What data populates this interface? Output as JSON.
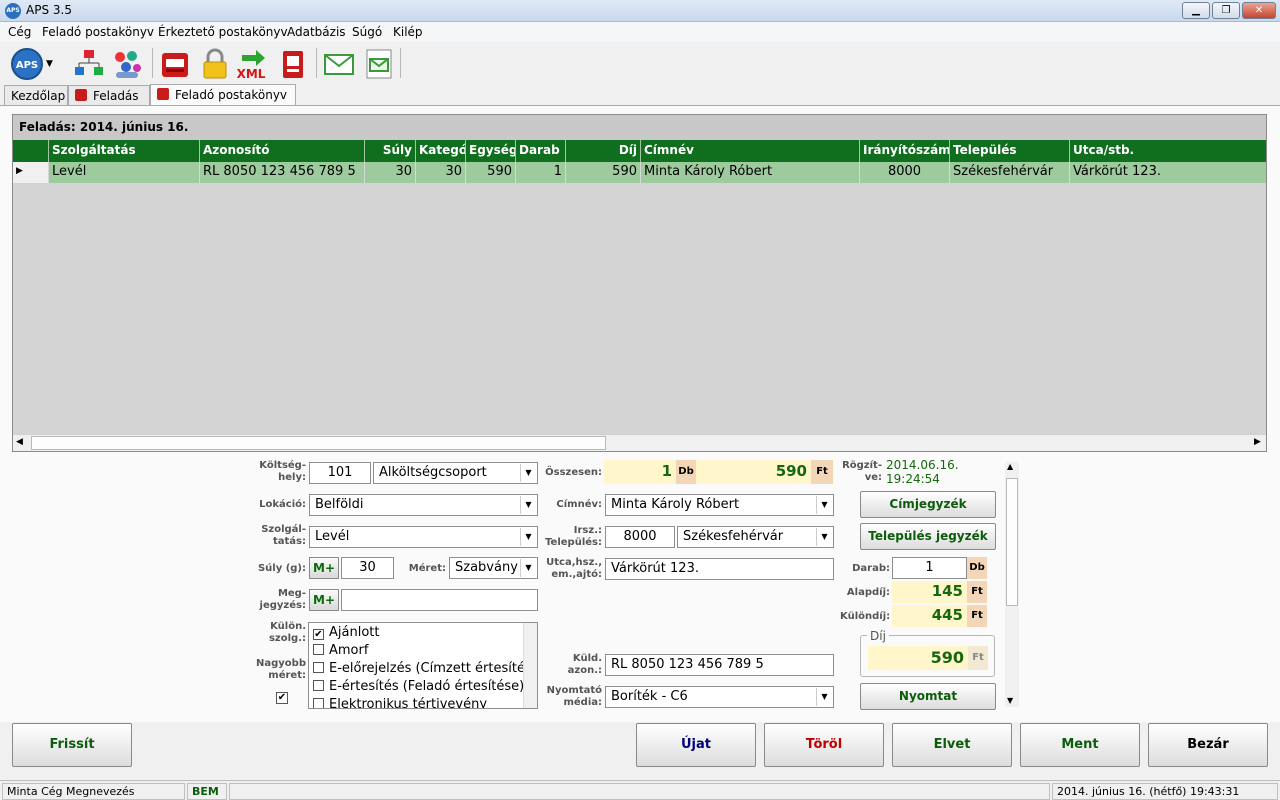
{
  "window": {
    "title": "APS 3.5",
    "minimize": "▁",
    "maximize": "❐",
    "close": "✕"
  },
  "menu": [
    "Cég",
    "Feladó postakönyv",
    "Érkeztető postakönyv",
    "Adatbázis",
    "Súgó",
    "Kilép"
  ],
  "toolbar": {
    "aps_label": "APS",
    "xml_label": "XML"
  },
  "tabs": [
    "Kezdőlap",
    "Feladás",
    "Feladó postakönyv"
  ],
  "grid": {
    "caption": "Feladás: 2014. június 16.",
    "columns": [
      "Szolgáltatás",
      "Azonosító",
      "Súly",
      "Kategó",
      "Egység",
      "Darab",
      "Díj",
      "Címnév",
      "Irányítószám",
      "Település",
      "Utca/stb."
    ],
    "row": [
      "Levél",
      "RL 8050 123 456 789 5",
      "30",
      "30",
      "590",
      "1",
      "590",
      "Minta Károly Róbert",
      "8000",
      "Székesfehérvár",
      "Várkörút 123."
    ]
  },
  "form": {
    "koltseghely_label": "Költség-\nhely:",
    "koltseghely_code": "101",
    "koltseghely_group": "Alköltségcsoport",
    "lokacio_label": "Lokáció:",
    "lokacio": "Belföldi",
    "szolgaltatas_label": "Szolgál-\ntatás:",
    "szolgaltatas": "Levél",
    "suly_label": "Súly (g):",
    "mplus": "M+",
    "suly": "30",
    "meret_label": "Méret:",
    "meret": "Szabvány",
    "megjegyzes_label": "Meg-\njegyzés:",
    "megjegyzes": "",
    "kulon_label": "Külön.\nszolg.:",
    "nagyobb_label": "Nagyobb\nméret:",
    "services": [
      {
        "label": "Ajánlott",
        "checked": "✔"
      },
      {
        "label": "Amorf",
        "checked": ""
      },
      {
        "label": "E-előrejelzés (Címzett értesítés",
        "checked": ""
      },
      {
        "label": "E-értesítés (Feladó értesítése)",
        "checked": ""
      },
      {
        "label": "Elektronikus tértivevény",
        "checked": ""
      }
    ],
    "osszesen_label": "Összesen:",
    "osszesen_db": "1",
    "db_unit": "Db",
    "osszesen_ft": "590",
    "ft_unit": "Ft",
    "cimnev_label": "Címnév:",
    "cimnev": "Minta Károly Róbert",
    "irsz_label": "Irsz.:\nTelepülés:",
    "irsz": "8000",
    "telepules": "Székesfehérvár",
    "utca_label": "Utca,hsz.,\nem.,ajtó:",
    "utca": "Várkörút 123.",
    "kuld_label": "Küld.\nazon.:",
    "kuld_azon": "RL 8050 123 456 789 5",
    "nyomtato_label": "Nyomtató\nmédia:",
    "nyomtato": "Boríték - C6",
    "rogzitve_label": "Rögzít-\nve:",
    "rogzitve_date": "2014.06.16.",
    "rogzitve_time": "19:24:54",
    "cimjegyzek": "Címjegyzék",
    "telepules_jegyzek": "Település jegyzék",
    "darab_label": "Darab:",
    "darab": "1",
    "alapdij_label": "Alapdíj:",
    "alapdij": "145",
    "kulondij_label": "Különdíj:",
    "kulondij": "445",
    "dij_label": "Díj",
    "dij": "590",
    "nyomtat": "Nyomtat"
  },
  "buttons": {
    "frissit": "Frissít",
    "ujat": "Újat",
    "torol": "Töröl",
    "elvet": "Elvet",
    "ment": "Ment",
    "bezar": "Bezár"
  },
  "status": {
    "company": "Minta Cég Megnevezés",
    "mode": "BEM",
    "datetime": "2014. június 16. (hétfő) 19:43:31"
  },
  "colors": {
    "grid_header": "#0f6f1f",
    "row_selected": "#9dcb9d",
    "value_green": "#16680e",
    "delete_red": "#c00000",
    "new_blue": "#00007a"
  }
}
